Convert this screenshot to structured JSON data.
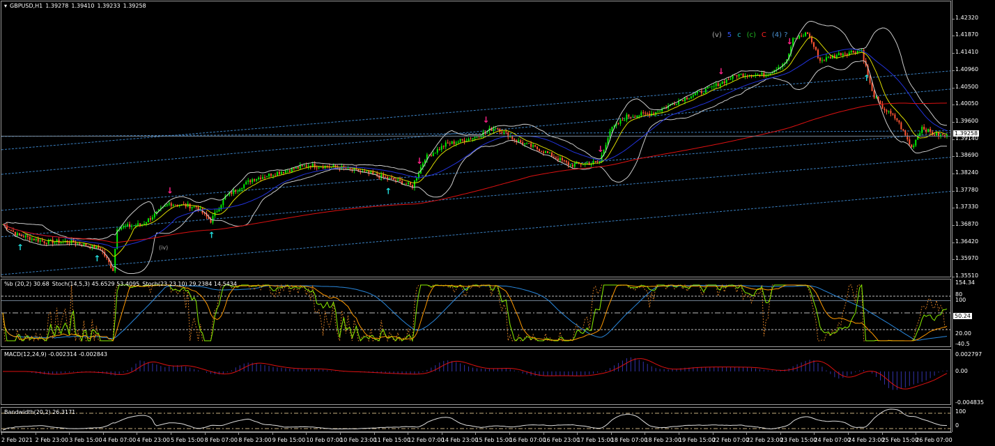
{
  "header": {
    "symbol": "GBPUSD,H1",
    "open": "1.39278",
    "high": "1.39410",
    "low": "1.39233",
    "close": "1.39258"
  },
  "price_axis": {
    "labels": [
      "1.42320",
      "1.41870",
      "1.41410",
      "1.40960",
      "1.40500",
      "1.40050",
      "1.39600",
      "1.39140",
      "1.38690",
      "1.38240",
      "1.37780",
      "1.37330",
      "1.36870",
      "1.36420",
      "1.35970",
      "1.35510"
    ],
    "current": "1.39258"
  },
  "wave_labels": [
    {
      "text": "(v)",
      "color": "#aaaaaa"
    },
    {
      "text": "5",
      "color": "#3355ff"
    },
    {
      "text": "c",
      "color": "#22bbbb"
    },
    {
      "text": "(c)",
      "color": "#22bb22"
    },
    {
      "text": "C",
      "color": "#ff2222"
    },
    {
      "text": "(4) ?",
      "color": "#4a90d0"
    }
  ],
  "wave_label_small": "(iv)",
  "oscillator": {
    "label_b": "%b (20,2) 30.68",
    "label_stoch1": "Stoch(14,5,3) 45.6529 53.4095",
    "label_stoch2": "Stoch(23,23,10) 29.2384 14.5434",
    "axis": [
      "154.34",
      "80",
      "100",
      "20.00",
      "-40.5"
    ],
    "current": "50.24"
  },
  "macd": {
    "label": "MACD(12,24,9) -0.002314 -0.002843",
    "axis": [
      "0.002797",
      "0.00",
      "-0.004835"
    ]
  },
  "bandwidth": {
    "label": "Bandwidth(20,2) 26.3171",
    "axis": [
      "100",
      "0"
    ]
  },
  "time_axis": [
    "2 Feb 2021",
    "2 Feb 23:00",
    "3 Feb 15:00",
    "4 Feb 07:00",
    "4 Feb 23:00",
    "5 Feb 15:00",
    "8 Feb 07:00",
    "8 Feb 23:00",
    "9 Feb 15:00",
    "10 Feb 07:00",
    "10 Feb 23:00",
    "11 Feb 15:00",
    "12 Feb 07:00",
    "14 Feb 23:00",
    "15 Feb 15:00",
    "16 Feb 07:00",
    "16 Feb 23:00",
    "17 Feb 15:00",
    "18 Feb 07:00",
    "18 Feb 23:00",
    "19 Feb 15:00",
    "22 Feb 07:00",
    "22 Feb 23:00",
    "23 Feb 15:00",
    "24 Feb 07:00",
    "24 Feb 23:00",
    "25 Feb 15:00",
    "26 Feb 07:00"
  ],
  "colors": {
    "bull": "#00ee00",
    "bear": "#ff5533",
    "ma_fast": "#dddd00",
    "ma_mid": "#2233dd",
    "ma_slow": "#dd1111",
    "bands": "#cccccc",
    "channel": "#3a7fc0",
    "arrow_up": "#22dddd",
    "arrow_down": "#ff2288"
  },
  "chart_data": {
    "type": "candlestick",
    "price_range": [
      1.3551,
      1.4232
    ],
    "bar_index": [
      0,
      7,
      20,
      33,
      47,
      53,
      55,
      67,
      80,
      93,
      100,
      107,
      120,
      133,
      147,
      160,
      173,
      187,
      197,
      203,
      213,
      227,
      237,
      247,
      260,
      273,
      287,
      292,
      300,
      313,
      327,
      340,
      353,
      367,
      377,
      380,
      387,
      393,
      403,
      413,
      418,
      422,
      430,
      437,
      442,
      447,
      453
    ],
    "close": [
      1.3693,
      1.3665,
      1.3647,
      1.3647,
      1.3628,
      1.3573,
      1.3684,
      1.3693,
      1.3748,
      1.3739,
      1.3702,
      1.3766,
      1.3812,
      1.3831,
      1.3849,
      1.3844,
      1.3831,
      1.3812,
      1.3794,
      1.3868,
      1.3904,
      1.3923,
      1.395,
      1.3914,
      1.3886,
      1.3849,
      1.3858,
      1.3941,
      1.3978,
      1.3987,
      1.4024,
      1.4052,
      1.4088,
      1.4088,
      1.4125,
      1.418,
      1.4199,
      1.4125,
      1.4144,
      1.4153,
      1.4042,
      1.4006,
      1.3969,
      1.3895,
      1.395,
      1.3932,
      1.39258
    ]
  }
}
